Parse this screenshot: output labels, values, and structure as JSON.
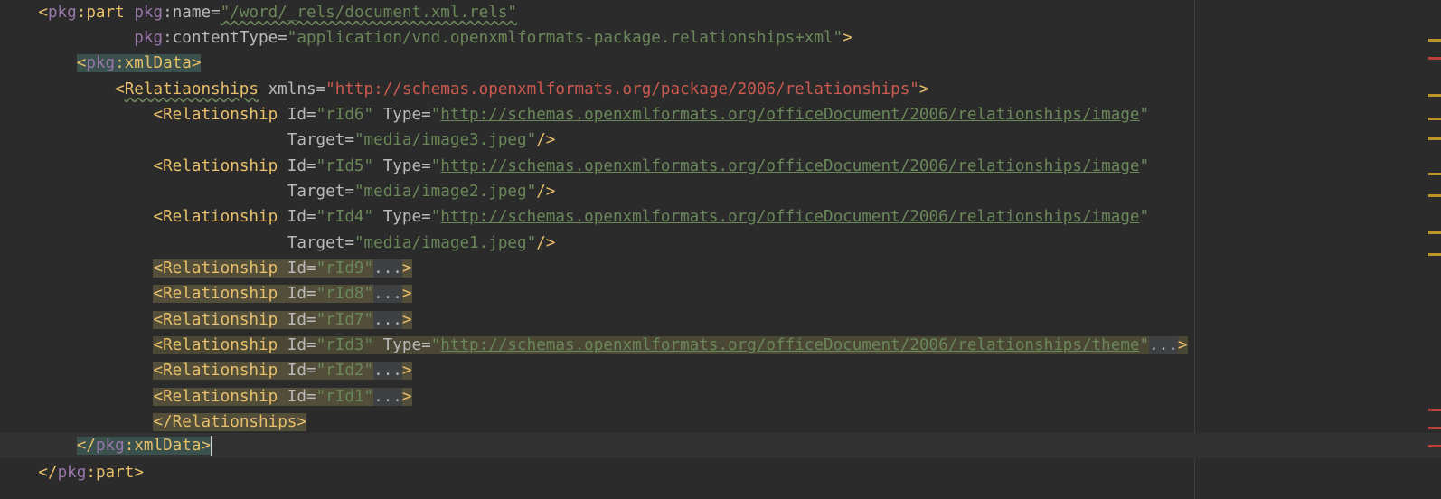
{
  "editor": {
    "lines": {
      "l1": {
        "indent": "    ",
        "ns": "pkg",
        "tag": "part",
        "attr_ns": "pkg",
        "attr": "name",
        "value": "\"/word/_rels/document.xml.rels\""
      },
      "l2": {
        "indent": "              ",
        "attr_ns": "pkg",
        "attr": "contentType",
        "value": "\"application/vnd.openxmlformats-package.relationships+xml\"",
        "close": ">"
      },
      "l3": {
        "indent": "        ",
        "ns": "pkg",
        "tag": "xmlData"
      },
      "l4": {
        "indent": "            ",
        "tag": "Relatiaonships",
        "attr": "xmlns",
        "value_url": "http://schemas.openxmlformats.org/package/2006/relationships"
      },
      "rel6": {
        "id": "\"rId6\"",
        "type_url": "http://schemas.openxmlformats.org/officeDocument/2006/relationships/image",
        "target": "\"media/image3.jpeg\""
      },
      "rel5": {
        "id": "\"rId5\"",
        "type_url": "http://schemas.openxmlformats.org/officeDocument/2006/relationships/image",
        "target": "\"media/image2.jpeg\""
      },
      "rel4": {
        "id": "\"rId4\"",
        "type_url": "http://schemas.openxmlformats.org/officeDocument/2006/relationships/image",
        "target": "\"media/image1.jpeg\""
      },
      "rel9": {
        "id": "\"rId9\""
      },
      "rel8": {
        "id": "\"rId8\""
      },
      "rel7": {
        "id": "\"rId7\""
      },
      "rel3": {
        "id": "\"rId3\"",
        "type_url": "http://schemas.openxmlformats.org/officeDocument/2006/relationships/theme"
      },
      "rel2": {
        "id": "\"rId2\""
      },
      "rel1": {
        "id": "\"rId1\""
      },
      "close_rels": {
        "tag": "Relationships"
      },
      "close_xmldata": {
        "ns": "pkg",
        "tag": "xmlData"
      },
      "close_part": {
        "ns": "pkg",
        "tag": "part"
      }
    },
    "common": {
      "relationship_tag": "Relationship",
      "id_attr": "Id",
      "type_attr": "Type",
      "target_attr": "Target",
      "ellipsis": "...",
      "eq": "=",
      "quote": "\"",
      "colon": ":"
    },
    "colors": {
      "background": "#2b2b2b",
      "tag": "#e8bf6a",
      "namespace": "#9876aa",
      "string": "#6a8759",
      "url_error": "#cc5a50",
      "marker_warning": "#bd9425",
      "marker_error": "#bc3f3c"
    }
  }
}
